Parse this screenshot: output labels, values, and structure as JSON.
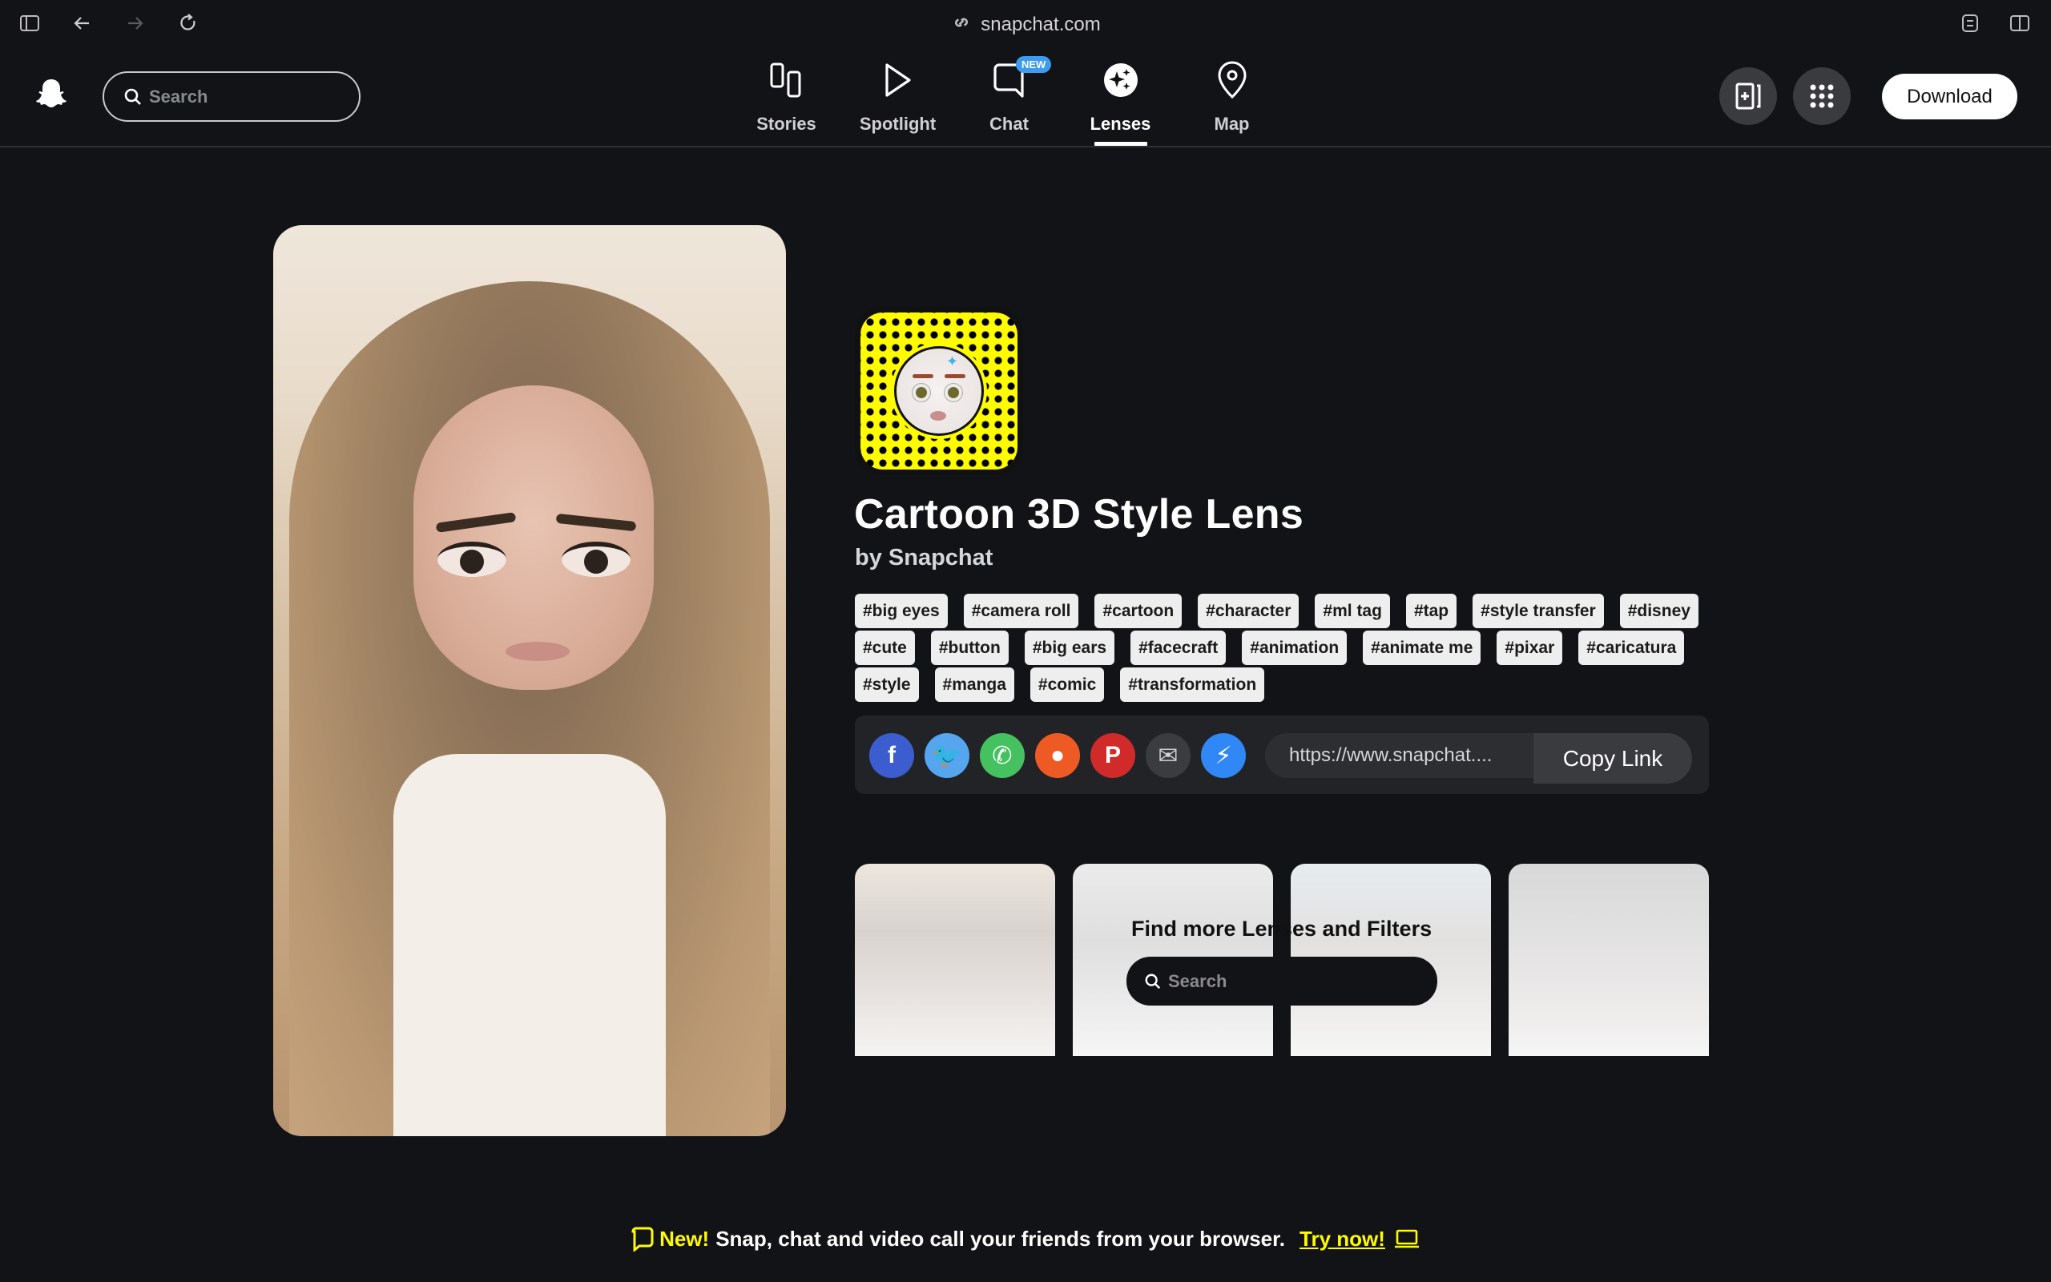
{
  "browser": {
    "url": "snapchat.com",
    "icons": [
      "sidebar-icon",
      "back-arrow-icon",
      "forward-arrow-icon",
      "reload-icon",
      "link-icon",
      "extensions-icon",
      "split-view-icon"
    ]
  },
  "header": {
    "search_placeholder": "Search",
    "nav": [
      {
        "label": "Stories",
        "icon": "stories-icon",
        "active": false
      },
      {
        "label": "Spotlight",
        "icon": "play-icon",
        "active": false
      },
      {
        "label": "Chat",
        "icon": "chat-bubble-icon",
        "active": false,
        "badge": "NEW"
      },
      {
        "label": "Lenses",
        "icon": "sparkles-icon",
        "active": true
      },
      {
        "label": "Map",
        "icon": "map-pin-icon",
        "active": false
      }
    ],
    "download_label": "Download",
    "colors": {
      "badge": "#3d9bf0",
      "background": "#121316"
    }
  },
  "lens": {
    "title": "Cartoon 3D Style Lens",
    "byline": "by Snapchat",
    "snapcode_color": "#fffc00",
    "tags": [
      "#big eyes",
      "#camera roll",
      "#cartoon",
      "#character",
      "#ml tag",
      "#tap",
      "#style transfer",
      "#disney",
      "#cute",
      "#button",
      "#big ears",
      "#facecraft",
      "#animation",
      "#animate me",
      "#pixar",
      "#caricatura",
      "#style",
      "#manga",
      "#comic",
      "#transformation"
    ]
  },
  "share": {
    "networks": [
      {
        "name": "Facebook",
        "glyph": "f",
        "color": "#3b5dd0"
      },
      {
        "name": "Twitter",
        "glyph": "🐦",
        "color": "#55a6ef"
      },
      {
        "name": "WhatsApp",
        "glyph": "✆",
        "color": "#45c160"
      },
      {
        "name": "Reddit",
        "glyph": "●",
        "color": "#ee5a24"
      },
      {
        "name": "Pinterest",
        "glyph": "P",
        "color": "#d12a2a"
      },
      {
        "name": "Email",
        "glyph": "✉",
        "color": "#3b3c40"
      },
      {
        "name": "Messenger",
        "glyph": "⚡",
        "color": "#2f88f5"
      }
    ],
    "link_value": "https://www.snapchat....",
    "copy_label": "Copy Link"
  },
  "discover": {
    "heading": "Find more Lenses and Filters",
    "search_placeholder": "Search"
  },
  "banner": {
    "new_label": "New!",
    "message": "Snap, chat and video call your friends from your browser.",
    "cta": "Try now!"
  }
}
